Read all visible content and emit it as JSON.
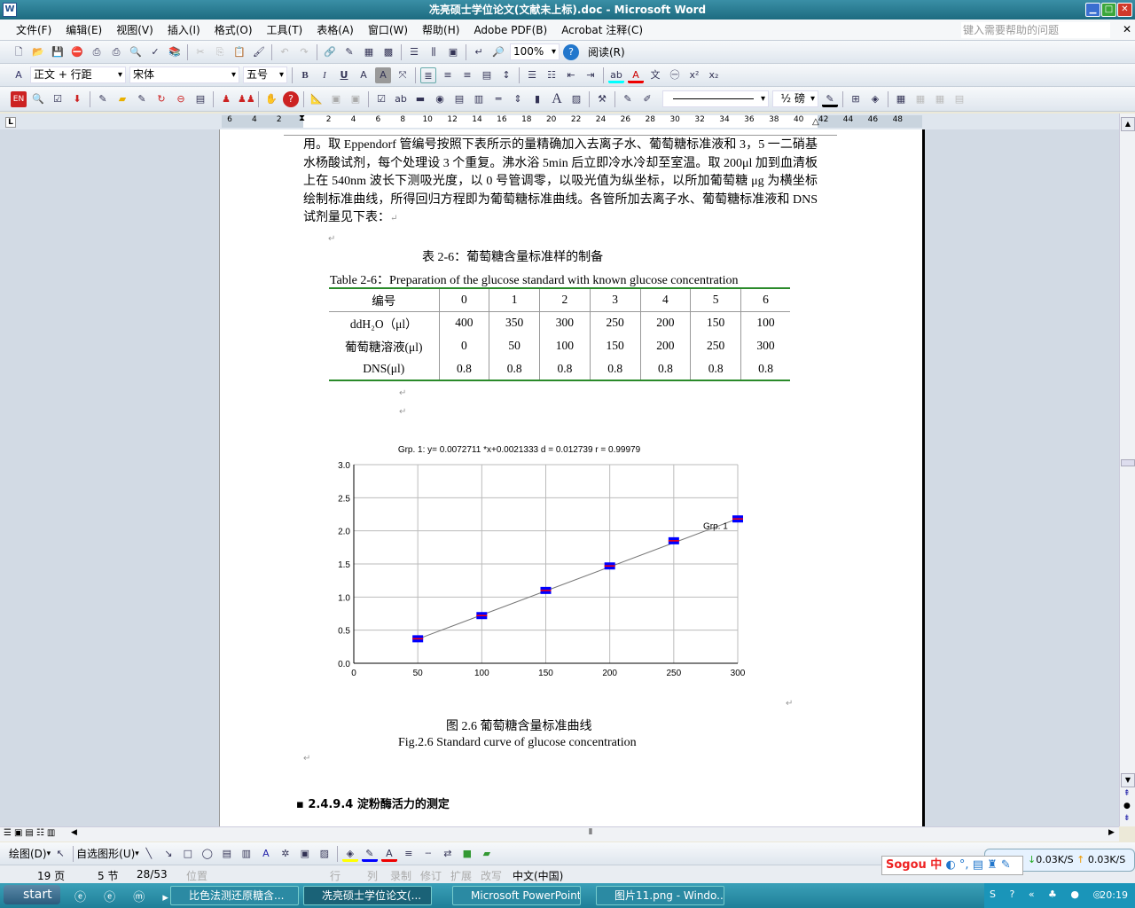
{
  "window": {
    "title": "冼亮硕士学位论文(文献未上标).doc - Microsoft Word",
    "app_icon": "W"
  },
  "menu": {
    "items": [
      "文件(F)",
      "编辑(E)",
      "视图(V)",
      "插入(I)",
      "格式(O)",
      "工具(T)",
      "表格(A)",
      "窗口(W)",
      "帮助(H)",
      "Adobe PDF(B)",
      "Acrobat 注释(C)"
    ],
    "help_placeholder": "键入需要帮助的问题"
  },
  "toolbar1": {
    "icons": [
      "new",
      "open",
      "save",
      "permission",
      "print-preview-pdf",
      "print",
      "print-preview",
      "spelling",
      "research",
      "|",
      "cut",
      "copy",
      "paste",
      "format-painter",
      "|",
      "undo",
      "redo",
      "|",
      "hyperlink",
      "tables-borders",
      "insert-table",
      "insert-excel",
      "|",
      "columns",
      "drawing",
      "document-map",
      "|",
      "show-hide",
      "reading-pane"
    ],
    "zoom": "100%",
    "read_label": "阅读(R)"
  },
  "toolbar2": {
    "style": "正文 + 行距",
    "font": "宋体",
    "size": "五号",
    "buttons": [
      "B",
      "I",
      "U"
    ]
  },
  "ruler": {
    "numbers": [
      "6",
      "4",
      "2",
      "",
      "2",
      "4",
      "6",
      "8",
      "10",
      "12",
      "14",
      "16",
      "18",
      "20",
      "22",
      "24",
      "26",
      "28",
      "30",
      "32",
      "34",
      "36",
      "38",
      "40",
      "42",
      "44",
      "46",
      "48"
    ]
  },
  "toolbar3": {
    "line_weight": "½ 磅"
  },
  "document": {
    "paragraph": "用。取 Eppendorf 管编号按照下表所示的量精确加入去离子水、葡萄糖标准液和 3，5 一二硝基水杨酸试剂，每个处理设 3 个重复。沸水浴 5min 后立即冷水冷却至室温。取 200μl 加到血清板上在 540nm 波长下测吸光度，以 0 号管调零，以吸光值为纵坐标，以所加葡萄糖 μg 为横坐标绘制标准曲线，所得回归方程即为葡萄糖标准曲线。各管所加去离子水、葡萄糖标准液和 DNS 试剂量见下表：",
    "table_caption_cn": "表 2-6：葡萄糖含量标准样的制备",
    "table_caption_en": "Table 2-6：Preparation of the glucose standard with known glucose concentration",
    "table": {
      "header": [
        "编号",
        "0",
        "1",
        "2",
        "3",
        "4",
        "5",
        "6"
      ],
      "rows": [
        [
          "ddH₂O（μl）",
          "400",
          "350",
          "300",
          "250",
          "200",
          "150",
          "100"
        ],
        [
          "葡萄糖溶液(μl)",
          "0",
          "50",
          "100",
          "150",
          "200",
          "250",
          "300"
        ],
        [
          "DNS(μl)",
          "0.8",
          "0.8",
          "0.8",
          "0.8",
          "0.8",
          "0.8",
          "0.8"
        ]
      ]
    },
    "figure_caption_cn": "图 2.6  葡萄糖含量标准曲线",
    "figure_caption_en": "Fig.2.6 Standard curve of glucose concentration",
    "heading": "2.4.9.4 淀粉酶活力的测定"
  },
  "chart_data": {
    "type": "scatter",
    "title": "Grp. 1: y= 0.0072711 *x+0.0021333  d = 0.012739  r = 0.99979",
    "x": [
      50,
      100,
      150,
      200,
      250,
      300
    ],
    "y": [
      0.37,
      0.72,
      1.1,
      1.47,
      1.85,
      2.18
    ],
    "series_label": "Grp. 1",
    "fit": {
      "slope": 0.0072711,
      "intercept": 0.0021333
    },
    "xlim": [
      0,
      300
    ],
    "ylim": [
      0,
      3
    ],
    "xticks": [
      "0",
      "50",
      "100",
      "150",
      "200",
      "250",
      "300"
    ],
    "yticks": [
      "0.0",
      "0.5",
      "1.0",
      "1.5",
      "2.0",
      "2.5",
      "3.0"
    ],
    "grid": true,
    "marker_color": "#0000ff",
    "errorbar_color": "#ff0000"
  },
  "drawbar": {
    "draw_label": "绘图(D)",
    "autoshape_label": "自选图形(U)"
  },
  "status": {
    "page": "19 页",
    "section": "5 节",
    "pages": "28/53",
    "position": "位置",
    "line": "行",
    "col": "列",
    "rec": "录制",
    "trk": "修订",
    "ext": "扩展",
    "ovr": "改写",
    "lang": "中文(中国)"
  },
  "taskbar": {
    "start": "start",
    "tasks": [
      "比色法测还原糖含...",
      "冼亮硕士学位论文(...",
      "Microsoft PowerPoint...",
      "图片11.png - Windo..."
    ],
    "clock": "20:19"
  },
  "net": {
    "down": "0.03K/S",
    "up": "0.03K/S"
  },
  "ime": {
    "label": "Sogou 中"
  }
}
